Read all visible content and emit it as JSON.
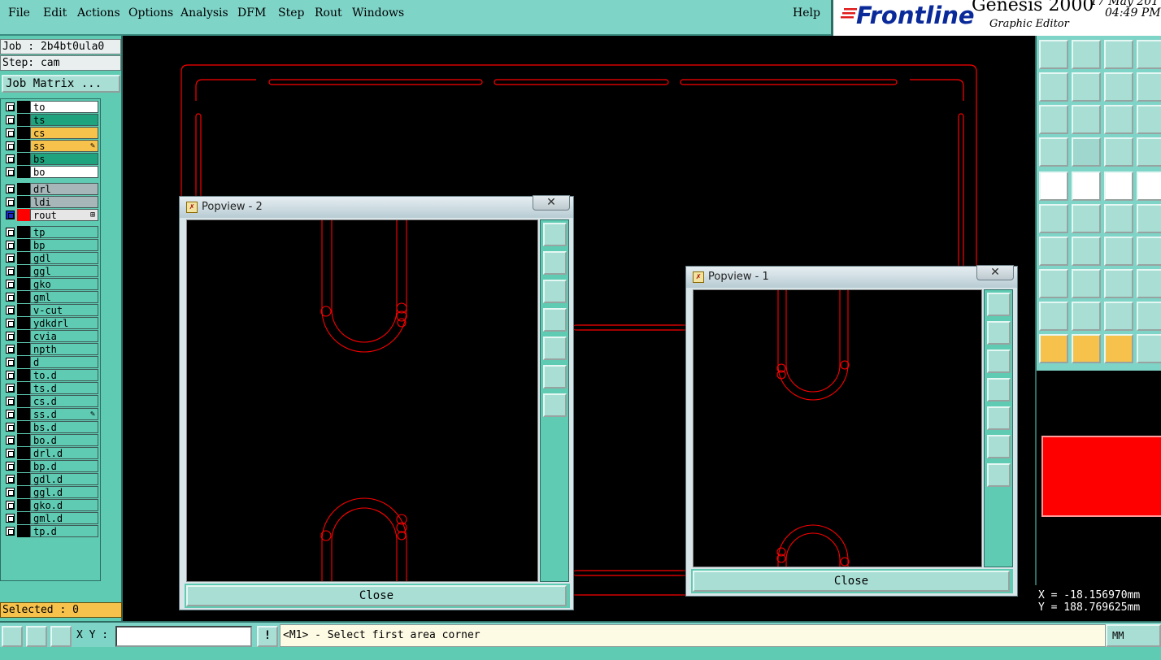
{
  "menu": {
    "items": [
      "File",
      "Edit",
      "Actions",
      "Options",
      "Analysis",
      "DFM",
      "Step",
      "Rout",
      "Windows"
    ],
    "help": "Help"
  },
  "brand": {
    "logo": "Frontline",
    "app": "Genesis 2000",
    "subtitle": "Graphic Editor",
    "date": "17 May 201",
    "time": "04:49 PM"
  },
  "left": {
    "job": "Job : 2b4bt0ula0",
    "step": "Step: cam",
    "job_matrix": "Job Matrix ...",
    "layers": [
      {
        "name": "to",
        "bg": "#ffffff",
        "swatch": "#000000"
      },
      {
        "name": "ts",
        "bg": "#1fa37f",
        "swatch": "#000000"
      },
      {
        "name": "cs",
        "bg": "#f7c24c",
        "swatch": "#000000"
      },
      {
        "name": "ss",
        "bg": "#f7c24c",
        "swatch": "#000000",
        "mark": "✎"
      },
      {
        "name": "bs",
        "bg": "#1fa37f",
        "swatch": "#000000"
      },
      {
        "name": "bo",
        "bg": "#ffffff",
        "swatch": "#000000"
      },
      {
        "name": "drl",
        "bg": "#a7b6b8",
        "swatch": "#000000"
      },
      {
        "name": "ldi",
        "bg": "#a7b6b8",
        "swatch": "#000000"
      },
      {
        "name": "rout",
        "bg": "#e6e6e6",
        "swatch": "#ff0000",
        "mark": "⊞",
        "active": true
      },
      {
        "name": "tp",
        "bg": "#5ecbb2",
        "swatch": "#000000"
      },
      {
        "name": "bp",
        "bg": "#5ecbb2",
        "swatch": "#000000"
      },
      {
        "name": "gdl",
        "bg": "#5ecbb2",
        "swatch": "#000000"
      },
      {
        "name": "ggl",
        "bg": "#5ecbb2",
        "swatch": "#000000"
      },
      {
        "name": "gko",
        "bg": "#5ecbb2",
        "swatch": "#000000"
      },
      {
        "name": "gml",
        "bg": "#5ecbb2",
        "swatch": "#000000"
      },
      {
        "name": "v-cut",
        "bg": "#5ecbb2",
        "swatch": "#000000"
      },
      {
        "name": "ydkdrl",
        "bg": "#5ecbb2",
        "swatch": "#000000"
      },
      {
        "name": "cvia",
        "bg": "#5ecbb2",
        "swatch": "#000000"
      },
      {
        "name": "npth",
        "bg": "#5ecbb2",
        "swatch": "#000000"
      },
      {
        "name": "d",
        "bg": "#5ecbb2",
        "swatch": "#000000"
      },
      {
        "name": "to.d",
        "bg": "#5ecbb2",
        "swatch": "#000000"
      },
      {
        "name": "ts.d",
        "bg": "#5ecbb2",
        "swatch": "#000000"
      },
      {
        "name": "cs.d",
        "bg": "#5ecbb2",
        "swatch": "#000000"
      },
      {
        "name": "ss.d",
        "bg": "#5ecbb2",
        "swatch": "#000000",
        "mark": "✎"
      },
      {
        "name": "bs.d",
        "bg": "#5ecbb2",
        "swatch": "#000000"
      },
      {
        "name": "bo.d",
        "bg": "#5ecbb2",
        "swatch": "#000000"
      },
      {
        "name": "drl.d",
        "bg": "#5ecbb2",
        "swatch": "#000000"
      },
      {
        "name": "bp.d",
        "bg": "#5ecbb2",
        "swatch": "#000000"
      },
      {
        "name": "gdl.d",
        "bg": "#5ecbb2",
        "swatch": "#000000"
      },
      {
        "name": "ggl.d",
        "bg": "#5ecbb2",
        "swatch": "#000000"
      },
      {
        "name": "gko.d",
        "bg": "#5ecbb2",
        "swatch": "#000000"
      },
      {
        "name": "gml.d",
        "bg": "#5ecbb2",
        "swatch": "#000000"
      },
      {
        "name": "tp.d",
        "bg": "#5ecbb2",
        "swatch": "#000000"
      }
    ],
    "selected": "Selected : 0"
  },
  "popview2": {
    "title": "Popview - 2",
    "close": "Close",
    "close_x": "✕"
  },
  "popview1": {
    "title": "Popview - 1",
    "close": "Close",
    "close_x": "✕"
  },
  "coords": {
    "x": "X = -18.156970mm",
    "y": "Y = 188.769625mm"
  },
  "status": {
    "xy_label": "X Y :",
    "xy_value": "",
    "alert": "!",
    "message": "<M1> - Select first area corner",
    "units": "MM"
  },
  "colors": {
    "outline": "#ff0000",
    "panel": "#5ecbb2",
    "menu": "#7fd4c8"
  }
}
